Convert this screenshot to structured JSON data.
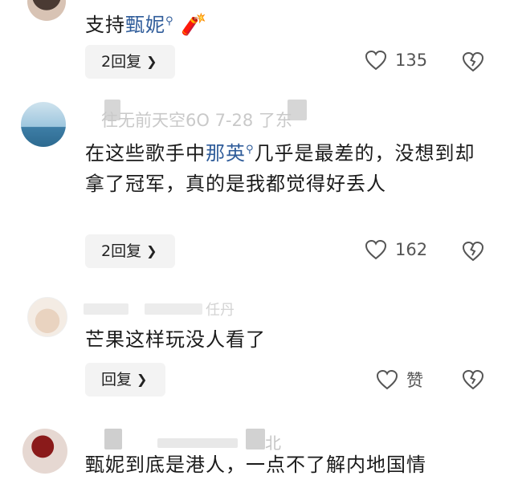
{
  "comments": [
    {
      "text_pre": "支持",
      "mention": "甄妮",
      "text_post": "",
      "emoji": "🧨",
      "reply_label": "2回复",
      "like_count": "135"
    },
    {
      "meta": "往无前天空6O  7-28  了东",
      "text_pre": "在这些歌手中",
      "mention": "那英",
      "text_post": "几乎是最差的，没想到却拿了冠军，真的是我都觉得好丢人",
      "reply_label": "2回复",
      "like_count": "162"
    },
    {
      "meta": "任丹",
      "text_pre": "芒果这样玩没人看了",
      "reply_label": "回复",
      "like_count": "赞"
    },
    {
      "meta": "北",
      "text_pre": "甄妮到底是港人，一点不了解内地国情"
    }
  ],
  "icons": {
    "like": "heart-outline-icon",
    "dislike": "broken-heart-icon",
    "mention": "search-magnifier-icon",
    "reply_chevron": "chevron-right-icon"
  },
  "colors": {
    "mention": "#2f5c9a",
    "reply_bg": "#f3f3f3"
  }
}
